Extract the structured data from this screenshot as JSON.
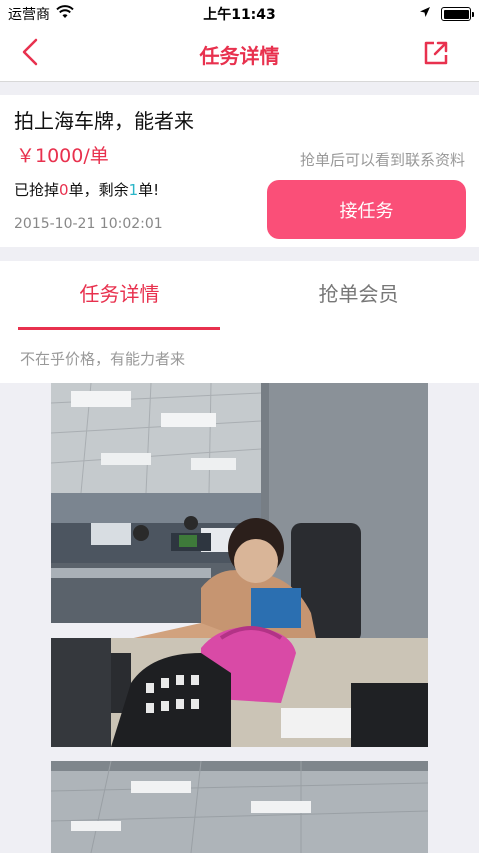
{
  "status_bar": {
    "carrier": "运营商",
    "time": "上午11:43"
  },
  "nav": {
    "title": "任务详情"
  },
  "task": {
    "title": "拍上海车牌，能者来",
    "price": "￥1000/单",
    "progress_prefix": "已抢掉",
    "taken_count": "0",
    "progress_middle": "单，剩余",
    "remaining_count": "1",
    "progress_suffix": "单!",
    "date": "2015-10-21 10:02:01",
    "hint": "抢单后可以看到联系资料",
    "accept_label": "接任务"
  },
  "tabs": [
    {
      "label": "任务详情",
      "active": true
    },
    {
      "label": "抢单会员",
      "active": false
    }
  ],
  "description": "不在乎价格，有能力者来",
  "colors": {
    "accent": "#e8314e",
    "button": "#fa4f78",
    "remaining": "#2bb5c8"
  },
  "icons": {
    "back": "chevron-left-icon",
    "share": "share-external-icon",
    "wifi": "wifi-icon",
    "location": "location-arrow-icon",
    "battery": "battery-icon"
  }
}
